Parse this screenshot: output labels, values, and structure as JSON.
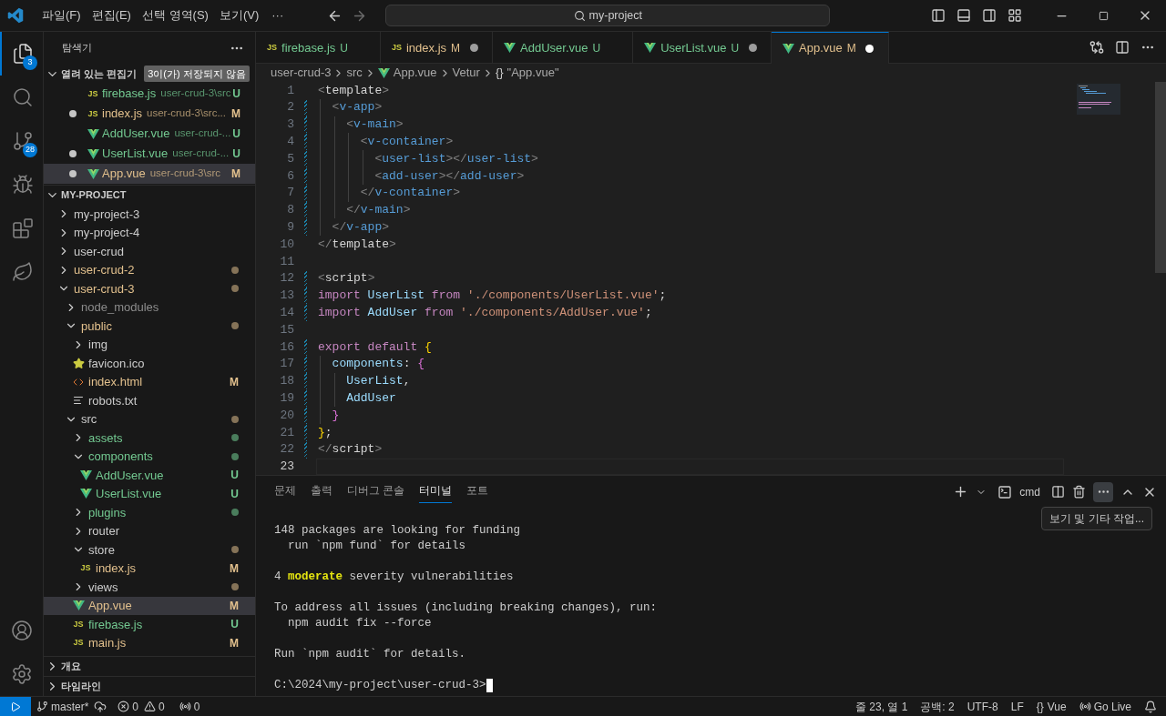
{
  "title_bar": {
    "menus": [
      "파일(F)",
      "편집(E)",
      "선택 영역(S)",
      "보기(V)"
    ],
    "more": "···",
    "search": "my-project",
    "forward_disabled": true
  },
  "activity_bar": [
    {
      "kind": "explorer",
      "selected": true,
      "badge": "3"
    },
    {
      "kind": "search",
      "selected": false
    },
    {
      "kind": "scm",
      "selected": false,
      "badge": "28"
    },
    {
      "kind": "debug",
      "selected": false
    },
    {
      "kind": "extensions",
      "selected": false
    },
    {
      "kind": "leaf",
      "selected": false
    }
  ],
  "activity_bottom": [
    {
      "kind": "account"
    },
    {
      "kind": "settings"
    }
  ],
  "sidebar": {
    "title": "탐색기",
    "open_editors": {
      "title": "열려 있는 편집기",
      "badge": "3이(가) 저장되지 않음",
      "expanded": true,
      "items": [
        {
          "label": "firebase.js",
          "path": "user-crud-3\\src",
          "kind": "js",
          "icon_label": "JS",
          "modified": false,
          "untracked": true,
          "badge": "U",
          "dirty": false,
          "selected": false
        },
        {
          "label": "index.js",
          "path": "user-crud-3\\src...",
          "kind": "js",
          "icon_label": "JS",
          "modified": true,
          "untracked": false,
          "badge": "M",
          "dirty": true,
          "selected": false
        },
        {
          "label": "AddUser.vue",
          "path": "user-crud-...",
          "kind": "vue",
          "modified": false,
          "untracked": true,
          "badge": "U",
          "dirty": false,
          "selected": false
        },
        {
          "label": "UserList.vue",
          "path": "user-crud-...",
          "kind": "vue",
          "modified": false,
          "untracked": true,
          "badge": "U",
          "dirty": true,
          "selected": false
        },
        {
          "label": "App.vue",
          "path": "user-crud-3\\src",
          "kind": "vue",
          "modified": true,
          "untracked": false,
          "badge": "M",
          "dirty": true,
          "selected": true
        }
      ]
    },
    "project": {
      "title": "MY-PROJECT",
      "expanded": true,
      "tree": [
        {
          "label": "my-project-3",
          "kind": "folder",
          "expanded": false,
          "modified": false,
          "untracked": false,
          "ignored": false,
          "selected": false
        },
        {
          "label": "my-project-4",
          "kind": "folder",
          "expanded": false,
          "modified": false,
          "untracked": false,
          "ignored": false,
          "selected": false
        },
        {
          "label": "user-crud",
          "kind": "folder",
          "expanded": false,
          "modified": false,
          "untracked": false,
          "ignored": false,
          "selected": false
        },
        {
          "label": "user-crud-2",
          "kind": "folder",
          "expanded": false,
          "modified": true,
          "untracked": false,
          "ignored": false,
          "color": "#857358",
          "selected": false
        },
        {
          "label": "user-crud-3",
          "kind": "folder",
          "expanded": true,
          "modified": true,
          "untracked": false,
          "ignored": false,
          "color": "#857358",
          "selected": false,
          "children": [
            {
              "label": "node_modules",
              "kind": "folder",
              "expanded": false,
              "modified": false,
              "untracked": false,
              "ignored": true,
              "selected": false
            },
            {
              "label": "public",
              "kind": "folder",
              "expanded": true,
              "modified": true,
              "untracked": false,
              "ignored": false,
              "color": "#857358",
              "selected": false,
              "children": [
                {
                  "label": "img",
                  "kind": "folder",
                  "expanded": false,
                  "modified": false,
                  "untracked": false,
                  "ignored": false,
                  "selected": false
                },
                {
                  "label": "favicon.ico",
                  "kind": "star",
                  "modified": false,
                  "untracked": false,
                  "ignored": false,
                  "selected": false
                },
                {
                  "label": "index.html",
                  "kind": "html",
                  "modified": true,
                  "untracked": false,
                  "ignored": false,
                  "badge": "M",
                  "selected": false
                },
                {
                  "label": "robots.txt",
                  "kind": "lines",
                  "modified": false,
                  "untracked": false,
                  "ignored": false,
                  "selected": false
                }
              ]
            },
            {
              "label": "src",
              "kind": "folder",
              "expanded": true,
              "modified": false,
              "untracked": false,
              "ignored": false,
              "color": "#857358",
              "selected": false,
              "children": [
                {
                  "label": "assets",
                  "kind": "folder",
                  "expanded": false,
                  "modified": false,
                  "untracked": true,
                  "ignored": false,
                  "color": "#4a7d5c",
                  "selected": false
                },
                {
                  "label": "components",
                  "kind": "folder",
                  "expanded": true,
                  "modified": false,
                  "untracked": true,
                  "ignored": false,
                  "color": "#4a7d5c",
                  "selected": false,
                  "children": [
                    {
                      "label": "AddUser.vue",
                      "kind": "vue",
                      "modified": false,
                      "untracked": true,
                      "ignored": false,
                      "badge": "U",
                      "selected": false
                    },
                    {
                      "label": "UserList.vue",
                      "kind": "vue",
                      "modified": false,
                      "untracked": true,
                      "ignored": false,
                      "badge": "U",
                      "selected": false
                    }
                  ]
                },
                {
                  "label": "plugins",
                  "kind": "folder",
                  "expanded": false,
                  "modified": false,
                  "untracked": true,
                  "ignored": false,
                  "color": "#4a7d5c",
                  "selected": false
                },
                {
                  "label": "router",
                  "kind": "folder",
                  "expanded": false,
                  "modified": false,
                  "untracked": false,
                  "ignored": false,
                  "selected": false
                },
                {
                  "label": "store",
                  "kind": "folder",
                  "expanded": true,
                  "modified": false,
                  "untracked": false,
                  "ignored": false,
                  "color": "#857358",
                  "selected": false,
                  "children": [
                    {
                      "label": "index.js",
                      "kind": "js",
                      "icon_label": "JS",
                      "modified": true,
                      "untracked": false,
                      "ignored": false,
                      "badge": "M",
                      "selected": false
                    }
                  ]
                },
                {
                  "label": "views",
                  "kind": "folder",
                  "expanded": false,
                  "modified": false,
                  "untracked": false,
                  "ignored": false,
                  "color": "#857358",
                  "selected": false
                },
                {
                  "label": "App.vue",
                  "kind": "vue",
                  "modified": true,
                  "untracked": false,
                  "ignored": false,
                  "badge": "M",
                  "selected": true
                },
                {
                  "label": "firebase.js",
                  "kind": "js",
                  "icon_label": "JS",
                  "modified": false,
                  "untracked": true,
                  "ignored": false,
                  "badge": "U",
                  "selected": false
                },
                {
                  "label": "main.js",
                  "kind": "js",
                  "icon_label": "JS",
                  "modified": true,
                  "untracked": false,
                  "ignored": false,
                  "badge": "M",
                  "selected": false
                }
              ]
            }
          ]
        }
      ]
    },
    "bottom_sections": [
      {
        "title": "개요",
        "expanded": false
      },
      {
        "title": "타임라인",
        "expanded": false
      }
    ]
  },
  "tabs": [
    {
      "label": "firebase.js",
      "kind": "js",
      "icon_label": "JS",
      "modified": false,
      "untracked": true,
      "badge": "U",
      "dirty": false,
      "selected": false
    },
    {
      "label": "index.js",
      "kind": "js",
      "icon_label": "JS",
      "modified": true,
      "untracked": false,
      "badge": "M",
      "dirty": true,
      "selected": false
    },
    {
      "label": "AddUser.vue",
      "kind": "vue",
      "modified": false,
      "untracked": true,
      "badge": "U",
      "dirty": false,
      "selected": false
    },
    {
      "label": "UserList.vue",
      "kind": "vue",
      "modified": false,
      "untracked": true,
      "badge": "U",
      "dirty": true,
      "selected": false
    },
    {
      "label": "App.vue",
      "kind": "vue",
      "modified": true,
      "untracked": false,
      "badge": "M",
      "dirty": true,
      "selected": true
    }
  ],
  "breadcrumbs": [
    {
      "text": "user-crud-3",
      "kind": "text"
    },
    {
      "text": "src",
      "kind": "text"
    },
    {
      "text": "App.vue",
      "kind": "vue"
    },
    {
      "text": "Vetur",
      "kind": "text"
    },
    {
      "text": "\"App.vue\"",
      "kind": "object",
      "icon_text": "{}"
    }
  ],
  "code": [
    {
      "number": "1",
      "modified": false,
      "current": false,
      "tokens": [
        {
          "t": "<",
          "kind": "punct"
        },
        {
          "t": "template",
          "kind": "plain"
        },
        {
          "t": ">",
          "kind": "punct"
        }
      ]
    },
    {
      "number": "2",
      "modified": true,
      "current": false,
      "tokens": [
        {
          "t": "  <",
          "kind": "punct"
        },
        {
          "t": "v-app",
          "kind": "tag"
        },
        {
          "t": ">",
          "kind": "punct"
        }
      ]
    },
    {
      "number": "3",
      "modified": true,
      "current": false,
      "tokens": [
        {
          "t": "    <",
          "kind": "punct"
        },
        {
          "t": "v-main",
          "kind": "tag"
        },
        {
          "t": ">",
          "kind": "punct"
        }
      ]
    },
    {
      "number": "4",
      "modified": true,
      "current": false,
      "tokens": [
        {
          "t": "      <",
          "kind": "punct"
        },
        {
          "t": "v-container",
          "kind": "tag"
        },
        {
          "t": ">",
          "kind": "punct"
        }
      ]
    },
    {
      "number": "5",
      "modified": true,
      "current": false,
      "tokens": [
        {
          "t": "        <",
          "kind": "punct"
        },
        {
          "t": "user-list",
          "kind": "tag"
        },
        {
          "t": "></",
          "kind": "punct"
        },
        {
          "t": "user-list",
          "kind": "tag"
        },
        {
          "t": ">",
          "kind": "punct"
        }
      ]
    },
    {
      "number": "6",
      "modified": true,
      "current": false,
      "tokens": [
        {
          "t": "        <",
          "kind": "punct"
        },
        {
          "t": "add-user",
          "kind": "tag"
        },
        {
          "t": "></",
          "kind": "punct"
        },
        {
          "t": "add-user",
          "kind": "tag"
        },
        {
          "t": ">",
          "kind": "punct"
        }
      ]
    },
    {
      "number": "7",
      "modified": true,
      "current": false,
      "tokens": [
        {
          "t": "      </",
          "kind": "punct"
        },
        {
          "t": "v-container",
          "kind": "tag"
        },
        {
          "t": ">",
          "kind": "punct"
        }
      ]
    },
    {
      "number": "8",
      "modified": true,
      "current": false,
      "tokens": [
        {
          "t": "    </",
          "kind": "punct"
        },
        {
          "t": "v-main",
          "kind": "tag"
        },
        {
          "t": ">",
          "kind": "punct"
        }
      ]
    },
    {
      "number": "9",
      "modified": true,
      "current": false,
      "tokens": [
        {
          "t": "  </",
          "kind": "punct"
        },
        {
          "t": "v-app",
          "kind": "tag"
        },
        {
          "t": ">",
          "kind": "punct"
        }
      ]
    },
    {
      "number": "10",
      "modified": false,
      "current": false,
      "tokens": [
        {
          "t": "</",
          "kind": "punct"
        },
        {
          "t": "template",
          "kind": "plain"
        },
        {
          "t": ">",
          "kind": "punct"
        }
      ]
    },
    {
      "number": "11",
      "modified": false,
      "current": false
    },
    {
      "number": "12",
      "modified": true,
      "current": false,
      "tokens": [
        {
          "t": "<",
          "kind": "punct"
        },
        {
          "t": "script",
          "kind": "plain"
        },
        {
          "t": ">",
          "kind": "punct"
        }
      ]
    },
    {
      "number": "13",
      "modified": true,
      "current": false,
      "tokens": [
        {
          "t": "import",
          "kind": "keyword"
        },
        {
          "t": " UserList ",
          "kind": "ident"
        },
        {
          "t": "from",
          "kind": "keyword"
        },
        {
          "t": " './components/UserList.vue'",
          "kind": "string"
        },
        {
          "t": ";",
          "kind": "plain"
        }
      ]
    },
    {
      "number": "14",
      "modified": true,
      "current": false,
      "tokens": [
        {
          "t": "import",
          "kind": "keyword"
        },
        {
          "t": " AddUser ",
          "kind": "ident"
        },
        {
          "t": "from",
          "kind": "keyword"
        },
        {
          "t": " './components/AddUser.vue'",
          "kind": "string"
        },
        {
          "t": ";",
          "kind": "plain"
        }
      ]
    },
    {
      "number": "15",
      "modified": false,
      "current": false
    },
    {
      "number": "16",
      "modified": true,
      "current": false,
      "tokens": [
        {
          "t": "export default ",
          "kind": "keyword"
        },
        {
          "t": "{",
          "kind": "brace1"
        }
      ]
    },
    {
      "number": "17",
      "modified": true,
      "current": false,
      "tokens": [
        {
          "t": "  components",
          "kind": "ident"
        },
        {
          "t": ": ",
          "kind": "plain"
        },
        {
          "t": "{",
          "kind": "brace2"
        }
      ]
    },
    {
      "number": "18",
      "modified": true,
      "current": false,
      "tokens": [
        {
          "t": "    UserList",
          "kind": "ident"
        },
        {
          "t": ",",
          "kind": "plain"
        }
      ]
    },
    {
      "number": "19",
      "modified": true,
      "current": false,
      "tokens": [
        {
          "t": "    AddUser",
          "kind": "ident"
        }
      ]
    },
    {
      "number": "20",
      "modified": true,
      "current": false,
      "tokens": [
        {
          "t": "  }",
          "kind": "brace2"
        }
      ]
    },
    {
      "number": "21",
      "modified": true,
      "current": false,
      "tokens": [
        {
          "t": "}",
          "kind": "brace1"
        },
        {
          "t": ";",
          "kind": "plain"
        }
      ]
    },
    {
      "number": "22",
      "modified": true,
      "current": false,
      "tokens": [
        {
          "t": "</",
          "kind": "punct"
        },
        {
          "t": "script",
          "kind": "plain"
        },
        {
          "t": ">",
          "kind": "punct"
        }
      ]
    },
    {
      "number": "23",
      "modified": false,
      "current": true
    }
  ],
  "panel": {
    "tabs": [
      {
        "label": "문제",
        "selected": false
      },
      {
        "label": "출력",
        "selected": false
      },
      {
        "label": "디버그 콘솔",
        "selected": false
      },
      {
        "label": "터미널",
        "selected": true
      },
      {
        "label": "포트",
        "selected": false
      }
    ],
    "terminal_name": "cmd",
    "tooltip": "보기 및 기타 작업...",
    "terminal_blocks": [
      [
        "148 packages are looking for funding",
        "  run `npm fund` for details"
      ],
      [
        "4 **moderate** severity vulnerabilities"
      ],
      [
        "To address all issues (including breaking changes), run:",
        "  npm audit fix --force"
      ],
      [
        "Run `npm audit` for details."
      ]
    ],
    "prompt": "C:\\2024\\my-project\\user-crud-3>"
  },
  "status_bar": {
    "branch": "master*",
    "errors": "0",
    "warnings": "0",
    "ports": "0",
    "position": "줄 23, 열 1",
    "spaces": "공백: 2",
    "encoding": "UTF-8",
    "eol": "LF",
    "language": "Vue",
    "language_icon": "{}",
    "live": "Go Live"
  }
}
